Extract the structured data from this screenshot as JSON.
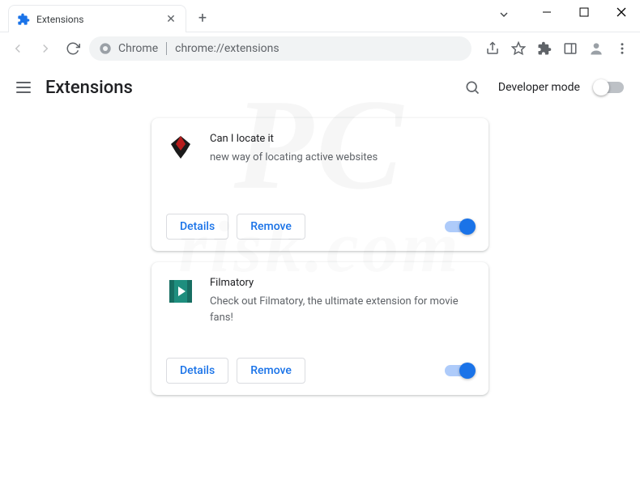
{
  "window": {
    "tab_title": "Extensions"
  },
  "omnibox": {
    "scheme_label": "Chrome",
    "path": "chrome://extensions"
  },
  "page": {
    "title": "Extensions",
    "dev_mode_label": "Developer mode",
    "dev_mode_on": false
  },
  "buttons": {
    "details": "Details",
    "remove": "Remove"
  },
  "extensions": [
    {
      "name": "Can I locate it",
      "description": "new way of locating active websites",
      "enabled": true,
      "icon": "bat"
    },
    {
      "name": "Filmatory",
      "description": "Check out Filmatory, the ultimate extension for movie fans!",
      "enabled": true,
      "icon": "film"
    }
  ],
  "watermark": {
    "top": "PC",
    "bottom": "risk.com"
  }
}
